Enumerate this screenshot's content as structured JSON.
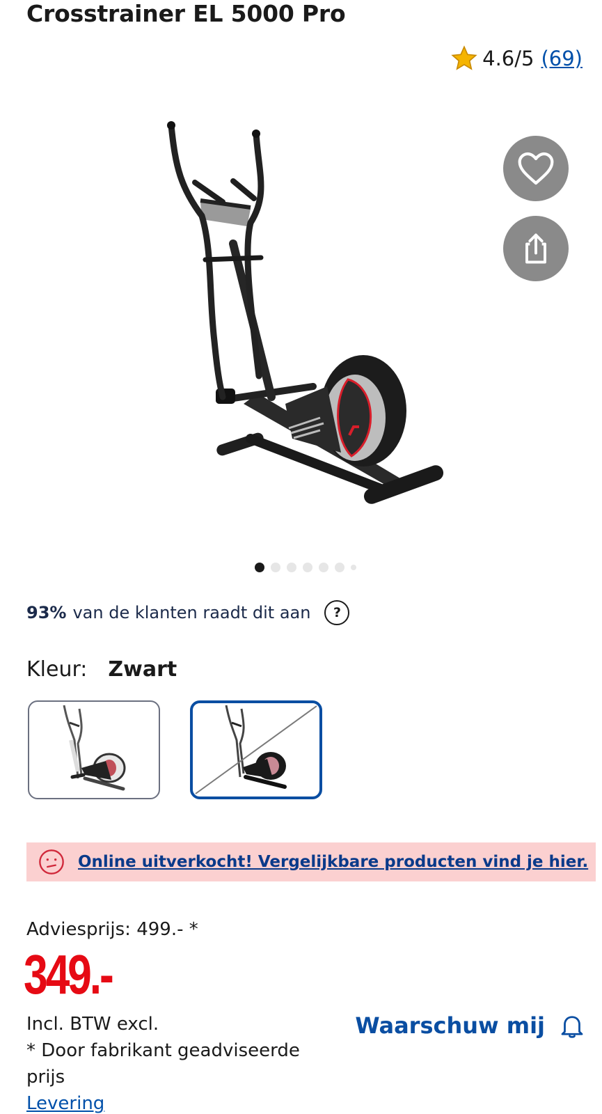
{
  "product": {
    "title": "Crosstrainer EL 5000 Pro"
  },
  "rating": {
    "score": "4.6/5",
    "count": "(69)",
    "star_color": "#f5b400"
  },
  "gallery": {
    "image_count": 7,
    "active_index": 0
  },
  "recommend": {
    "percent": "93%",
    "text": "van de klanten raadt dit aan",
    "help_label": "?"
  },
  "color": {
    "label": "Kleur:",
    "value": "Zwart",
    "options": [
      {
        "name": "white-variant",
        "selected": false,
        "available": true
      },
      {
        "name": "black-variant",
        "selected": true,
        "available": false
      }
    ]
  },
  "alert": {
    "message": "Online uitverkocht! Vergelijkbare producten vind je hier.",
    "bg_color": "#fbd0d0"
  },
  "pricing": {
    "advies": "Adviesprijs: 499.- *",
    "price": "349.-",
    "price_color": "#e60a14",
    "incl": "Incl. BTW excl.",
    "note": "* Door fabrikant geadviseerde prijs",
    "levering": "Levering"
  },
  "notify": {
    "label": "Waarschuw mij"
  }
}
